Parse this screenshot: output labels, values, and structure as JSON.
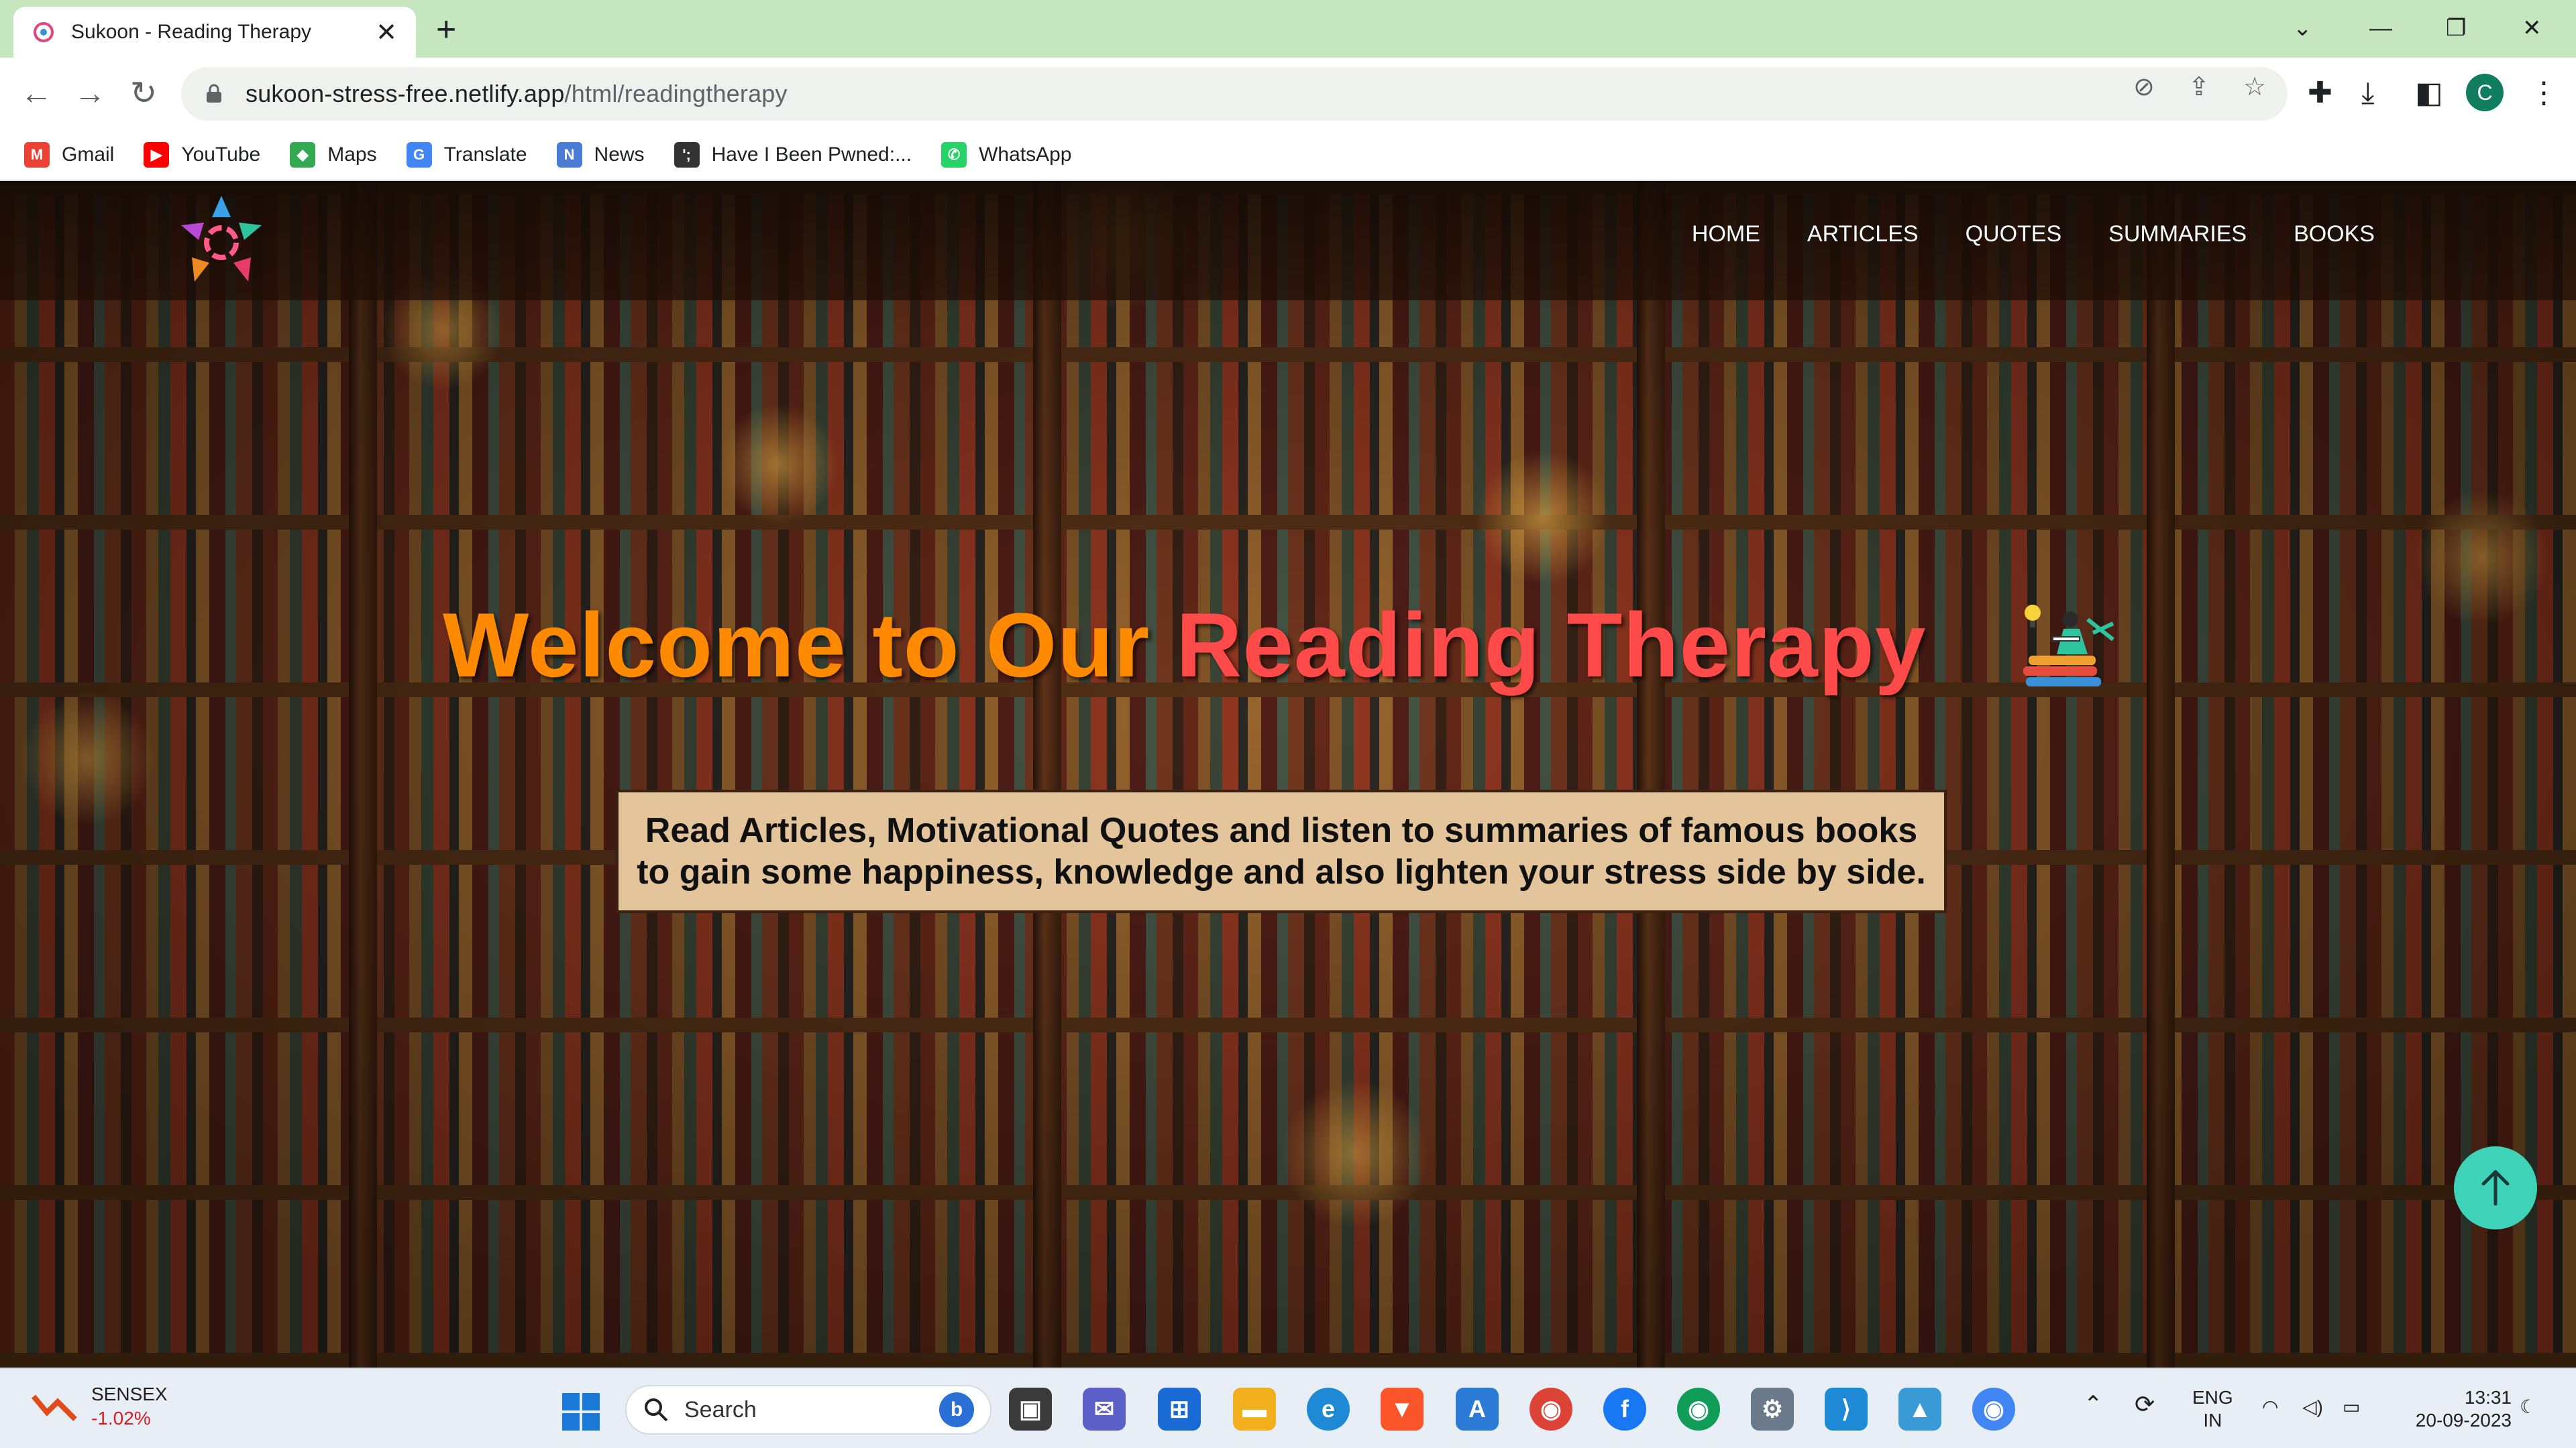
{
  "browser": {
    "tab_title": "Sukoon - Reading Therapy",
    "tab_close": "✕",
    "new_tab": "+",
    "url_host": "sukoon-stress-free.netlify.app",
    "url_path": "/html/readingtherapy",
    "profile_initial": "C",
    "window_controls": {
      "dropdown": "⌄",
      "minimize": "—",
      "restore": "❐",
      "close": "✕"
    }
  },
  "bookmarks": [
    {
      "label": "Gmail",
      "icon": "gmail-icon",
      "color": "#ea4335",
      "glyph": "M"
    },
    {
      "label": "YouTube",
      "icon": "youtube-icon",
      "color": "#ff0000",
      "glyph": "▶"
    },
    {
      "label": "Maps",
      "icon": "maps-icon",
      "color": "#34a853",
      "glyph": "◆"
    },
    {
      "label": "Translate",
      "icon": "translate-icon",
      "color": "#4285f4",
      "glyph": "G"
    },
    {
      "label": "News",
      "icon": "news-icon",
      "color": "#4a7cd6",
      "glyph": "N"
    },
    {
      "label": "Have I Been Pwned:...",
      "icon": "pwned-icon",
      "color": "#333333",
      "glyph": "';"
    },
    {
      "label": "WhatsApp",
      "icon": "whatsapp-icon",
      "color": "#25d366",
      "glyph": "✆"
    }
  ],
  "site": {
    "nav": [
      "HOME",
      "ARTICLES",
      "QUOTES",
      "SUMMARIES",
      "BOOKS"
    ],
    "hero_title_part1": "Welcome to Our ",
    "hero_title_part2": "Reading Therapy",
    "hero_sub_line1": "Read Articles, Motivational Quotes and listen to summaries of famous books",
    "hero_sub_line2": "to gain some happiness, knowledge and also lighten your stress side by side.",
    "to_top_icon": "arrow-up-icon",
    "colors": {
      "title_orange": "#ff8a00",
      "title_red": "#ff4a4a",
      "subtitle_bg": "#e4c49a",
      "to_top": "#3ed2b8"
    }
  },
  "taskbar": {
    "stock_name": "SENSEX",
    "stock_change": "-1.02%",
    "search_label": "Search",
    "language_line1": "ENG",
    "language_line2": "IN",
    "time": "13:31",
    "date": "20-09-2023"
  }
}
